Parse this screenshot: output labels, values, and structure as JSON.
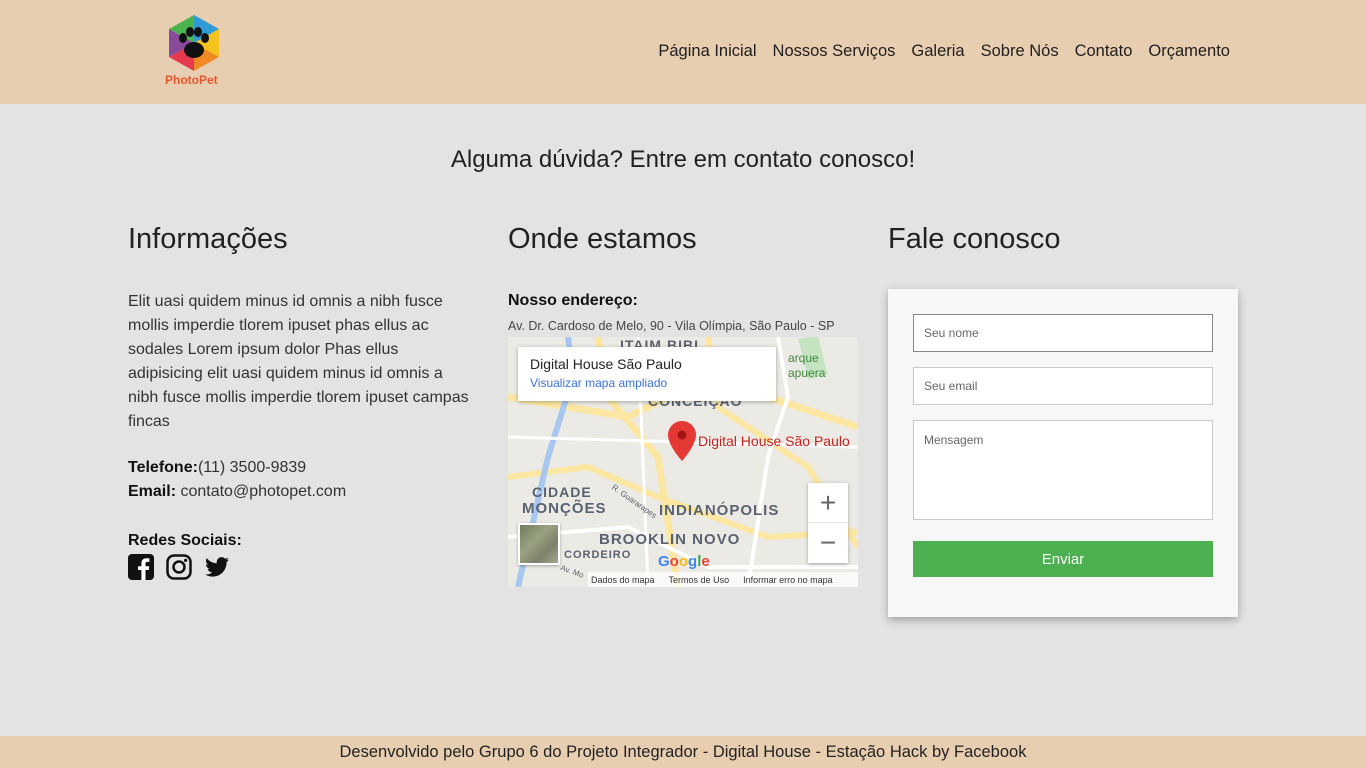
{
  "header": {
    "logo_text": "PhotoPet",
    "nav": [
      "Página Inicial",
      "Nossos Serviços",
      "Galeria",
      "Sobre Nós",
      "Contato",
      "Orçamento"
    ]
  },
  "main": {
    "headline": "Alguma dúvida? Entre em contato conosco!",
    "info": {
      "title": "Informações",
      "text": "Elit uasi quidem minus id omnis a nibh fusce mollis imperdie tlorem ipuset phas ellus ac sodales Lorem ipsum dolor Phas ellus adipisicing elit uasi quidem minus id omnis a nibh fusce mollis imperdie tlorem ipuset campas fincas",
      "phone_label": "Telefone:",
      "phone": "(11) 3500-9839",
      "email_label": "Email:",
      "email": "contato@photopet.com",
      "social_title": "Redes Sociais:",
      "social_icons": [
        "facebook-icon",
        "instagram-icon",
        "twitter-icon"
      ]
    },
    "location": {
      "title": "Onde estamos",
      "address_label": "Nosso endereço:",
      "address": "Av. Dr. Cardoso de Melo, 90 - Vila Olímpia, São Paulo - SP",
      "map": {
        "card_title": "Digital House São Paulo",
        "card_link": "Visualizar mapa ampliado",
        "pin_label": "Digital House São Paulo",
        "labels": [
          "ITAIM BIBI",
          "CONCEIÇÃO",
          "CIDADE",
          "MONÇÕES",
          "INDIANÓPOLIS",
          "BROOKLIN NOVO",
          "CORDEIRO",
          "arque",
          "apuera",
          "R. Guararapes",
          "Av. Mo"
        ],
        "zoom_in": "+",
        "zoom_out": "−",
        "google": "Google",
        "footer": [
          "Dados do mapa",
          "Termos de Uso",
          "Informar erro no mapa"
        ]
      }
    },
    "contact_form": {
      "title": "Fale conosco",
      "name_placeholder": "Seu nome",
      "email_placeholder": "Seu email",
      "message_placeholder": "Mensagem",
      "submit": "Enviar"
    }
  },
  "footer": {
    "text": "Desenvolvido pelo Grupo 6 do Projeto Integrador - Digital House - Estação Hack by Facebook"
  },
  "colors": {
    "header_bg": "#e8ceb0",
    "page_bg": "#e3e3e3",
    "button_bg": "#4caf50",
    "pin_red": "#e53935"
  }
}
